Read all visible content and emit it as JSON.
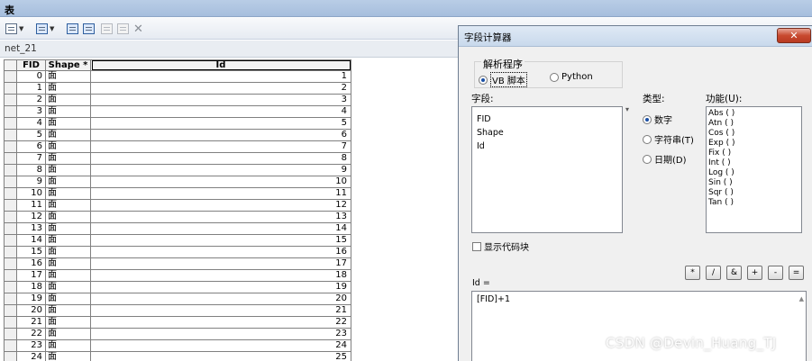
{
  "window": {
    "title": "表"
  },
  "tab": {
    "label": "net_21"
  },
  "table": {
    "columns": [
      "FID",
      "Shape *",
      "Id"
    ],
    "rows": [
      [
        "0",
        "面",
        "1"
      ],
      [
        "1",
        "面",
        "2"
      ],
      [
        "2",
        "面",
        "3"
      ],
      [
        "3",
        "面",
        "4"
      ],
      [
        "4",
        "面",
        "5"
      ],
      [
        "5",
        "面",
        "6"
      ],
      [
        "6",
        "面",
        "7"
      ],
      [
        "7",
        "面",
        "8"
      ],
      [
        "8",
        "面",
        "9"
      ],
      [
        "9",
        "面",
        "10"
      ],
      [
        "10",
        "面",
        "11"
      ],
      [
        "11",
        "面",
        "12"
      ],
      [
        "12",
        "面",
        "13"
      ],
      [
        "13",
        "面",
        "14"
      ],
      [
        "14",
        "面",
        "15"
      ],
      [
        "15",
        "面",
        "16"
      ],
      [
        "16",
        "面",
        "17"
      ],
      [
        "17",
        "面",
        "18"
      ],
      [
        "18",
        "面",
        "19"
      ],
      [
        "19",
        "面",
        "20"
      ],
      [
        "20",
        "面",
        "21"
      ],
      [
        "21",
        "面",
        "22"
      ],
      [
        "22",
        "面",
        "23"
      ],
      [
        "23",
        "面",
        "24"
      ],
      [
        "24",
        "面",
        "25"
      ]
    ]
  },
  "dialog": {
    "title": "字段计算器",
    "close_symbol": "✕",
    "parser": {
      "legend": "解析程序",
      "options": [
        {
          "label": "VB 脚本",
          "selected": true
        },
        {
          "label": "Python",
          "selected": false
        }
      ]
    },
    "fields": {
      "label": "字段:",
      "items": [
        "FID",
        "Shape",
        "Id"
      ]
    },
    "type": {
      "label": "类型:",
      "options": [
        {
          "label": "数字",
          "selected": true
        },
        {
          "label": "字符串(T)",
          "selected": false
        },
        {
          "label": "日期(D)",
          "selected": false
        }
      ]
    },
    "functions": {
      "label": "功能(U):",
      "items": [
        "Abs ( )",
        "Atn ( )",
        "Cos ( )",
        "Exp ( )",
        "Fix ( )",
        "Int ( )",
        "Log ( )",
        "Sin ( )",
        "Sqr ( )",
        "Tan ( )"
      ]
    },
    "show_codeblock": {
      "label": "显示代码块",
      "checked": false
    },
    "operators": [
      "*",
      "/",
      "&",
      "+",
      "-",
      "="
    ],
    "expression": {
      "target_label": "Id =",
      "code": "[FID]+1"
    }
  },
  "watermark": "CSDN @Devin_Huang_TJ"
}
